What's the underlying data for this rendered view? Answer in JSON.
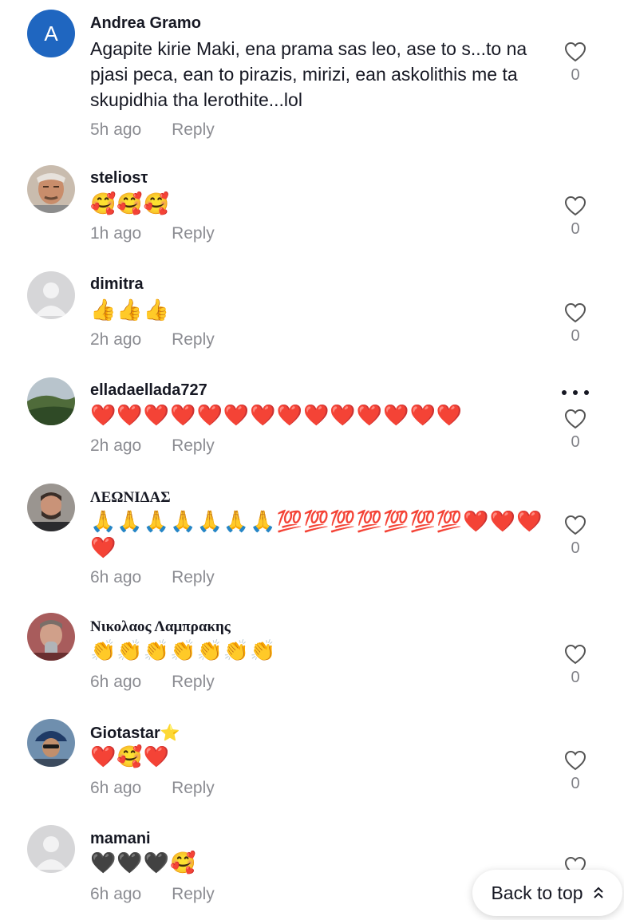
{
  "comments": [
    {
      "username": "Andrea Gramo",
      "avatar_letter": "A",
      "text": "Agapite kirie Maki, ena prama sas leo, ase to s...to na pjasi peca, ean to pirazis, mirizi, ean askolithis me ta skupidhia tha lerothite...lol",
      "time": "5h ago",
      "reply": "Reply",
      "likes": "0"
    },
    {
      "username": "steliosτ",
      "text": "🥰🥰🥰",
      "time": "1h ago",
      "reply": "Reply",
      "likes": "0"
    },
    {
      "username": "dimitra",
      "text": "👍👍👍",
      "time": "2h ago",
      "reply": "Reply",
      "likes": "0"
    },
    {
      "username": "elladaellada727",
      "text": "❤️❤️❤️❤️❤️❤️❤️❤️❤️❤️❤️❤️❤️❤️",
      "time": "2h ago",
      "reply": "Reply",
      "likes": "0"
    },
    {
      "username": "ΛΕΩΝΙΔΑΣ",
      "text": "🙏🙏🙏🙏🙏🙏🙏💯💯💯💯💯💯💯❤️❤️❤️❤️",
      "time": "6h ago",
      "reply": "Reply",
      "likes": "0"
    },
    {
      "username": "Νικολαος Λαμπρακης",
      "text": "👏👏👏👏👏👏👏",
      "time": "6h ago",
      "reply": "Reply",
      "likes": "0"
    },
    {
      "username": "Giotastar⭐",
      "text": "❤️🥰❤️",
      "time": "6h ago",
      "reply": "Reply",
      "likes": "0"
    },
    {
      "username": "mamani",
      "text": "🖤🖤🖤🥰",
      "time": "6h ago",
      "reply": "Reply"
    }
  ],
  "back_to_top": "Back to top",
  "icons": {
    "like": "heart-outline-icon",
    "more": "more-options-icon",
    "back_to_top": "double-chevron-up-icon",
    "default_avatar": "user-silhouette-icon"
  },
  "colors": {
    "avatar_letter_bg": "#1f66c0",
    "muted_text": "#8a8b91",
    "heart_outline": "#555555"
  }
}
